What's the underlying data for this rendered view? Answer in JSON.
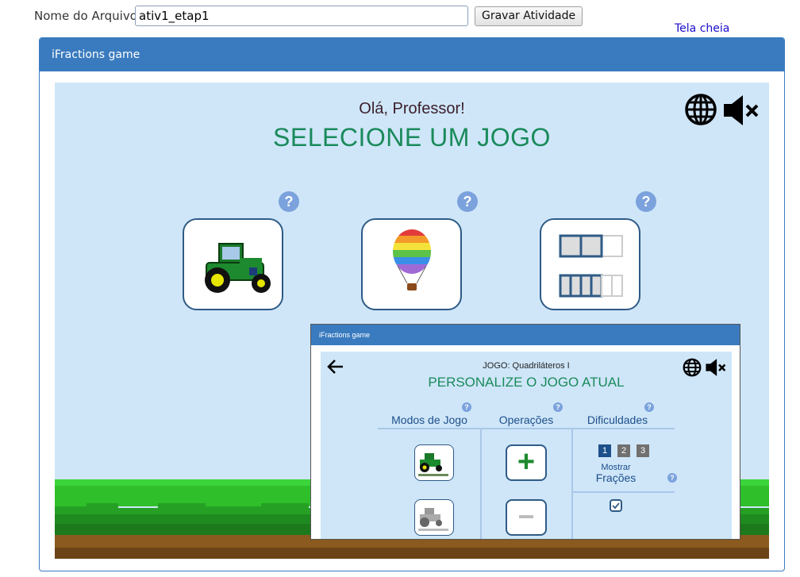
{
  "top": {
    "file_label": "Nome do Arquivo:",
    "file_value": "ativ1_etap1",
    "save_label": "Gravar Atividade",
    "fullscreen_label": "Tela cheia"
  },
  "panel": {
    "title": "iFractions game"
  },
  "game": {
    "greeting": "Olá, Professor!",
    "title": "SELECIONE UM JOGO",
    "help_glyph": "?",
    "games": [
      {
        "icon": "tractor-icon"
      },
      {
        "icon": "hot-air-balloon-icon"
      },
      {
        "icon": "squares-fraction-icon"
      }
    ]
  },
  "inner": {
    "header_title": "iFractions game",
    "game_label": "JOGO: Quadriláteros I",
    "title": "PERSONALIZE O JOGO ATUAL",
    "columns": {
      "modes": "Modos de Jogo",
      "operations": "Operações",
      "difficulties": "Dificuldades"
    },
    "operations": {
      "plus": "+",
      "minus": "−"
    },
    "difficulty_levels": [
      "1",
      "2",
      "3"
    ],
    "selected_difficulty": "1",
    "show_label_line1": "Mostrar",
    "show_label_line2": "Frações",
    "show_fractions_checked": true
  },
  "colors": {
    "header_blue": "#3a7bbf",
    "game_bg": "#cfe6f9",
    "title_green": "#1a8a5a",
    "help_blue": "#7ba2dc"
  }
}
